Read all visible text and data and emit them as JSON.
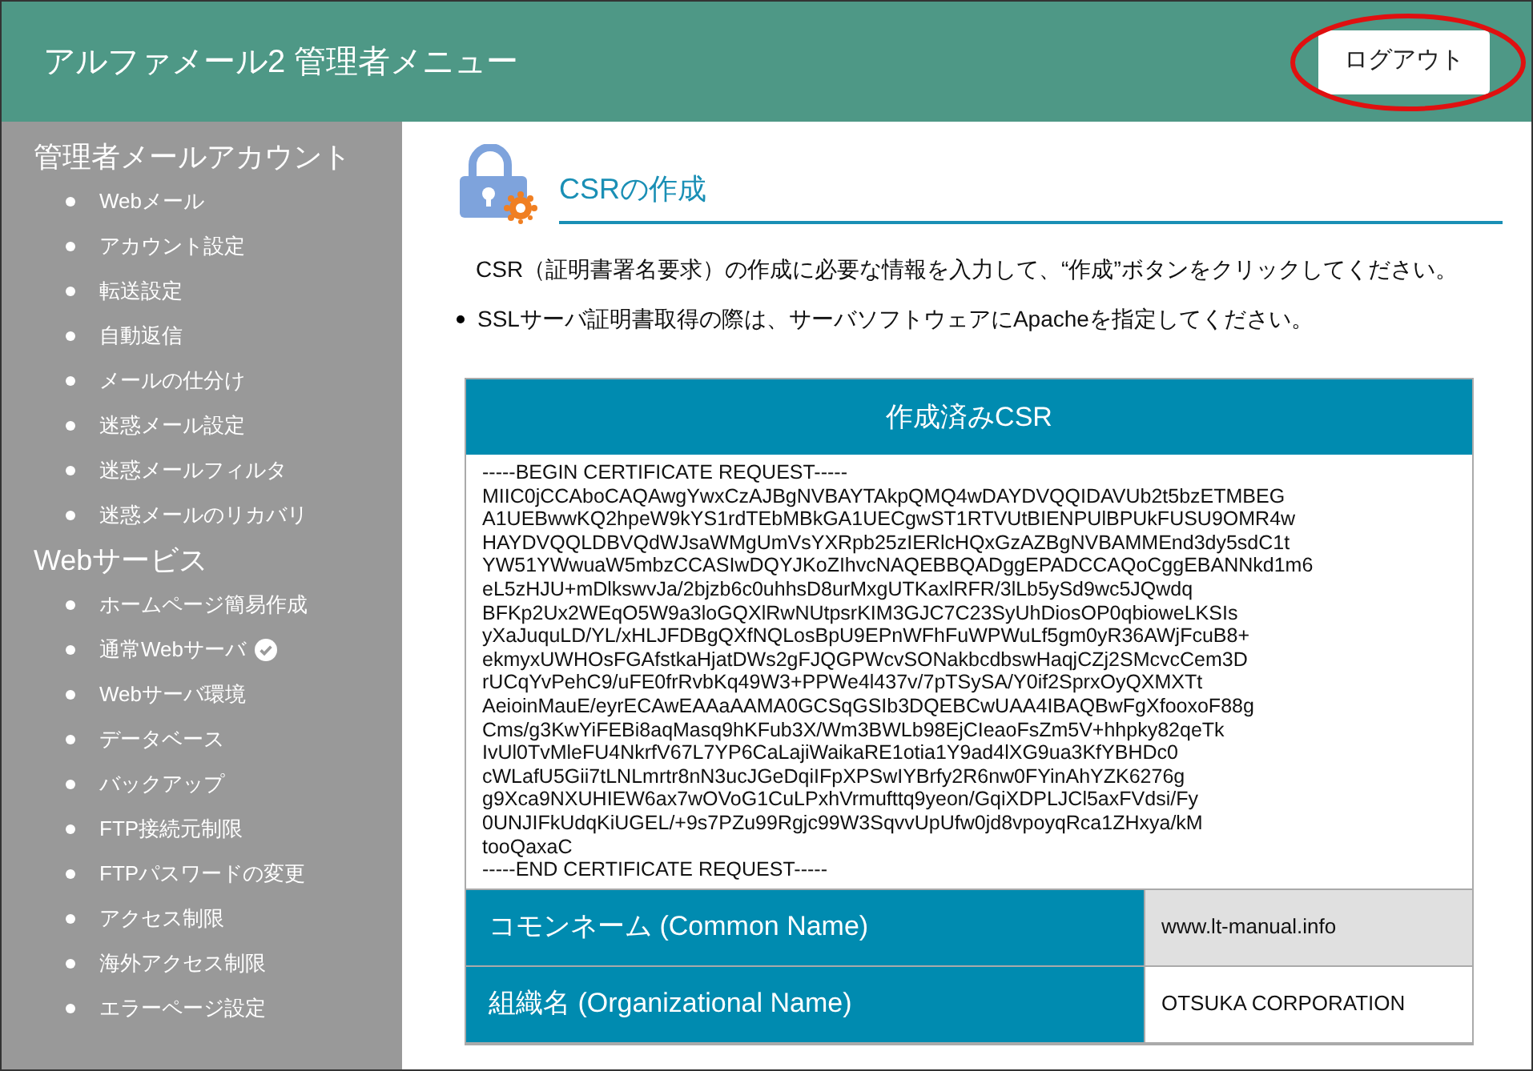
{
  "header": {
    "title": "アルファメール2 管理者メニュー",
    "logout_button": "ログアウト",
    "logout_circled": true
  },
  "sidebar": {
    "sections": [
      {
        "title": "管理者メールアカウント",
        "items": [
          {
            "label": "Webメール",
            "verified": false
          },
          {
            "label": "アカウント設定",
            "verified": false
          },
          {
            "label": "転送設定",
            "verified": false
          },
          {
            "label": "自動返信",
            "verified": false
          },
          {
            "label": "メールの仕分け",
            "verified": false
          },
          {
            "label": "迷惑メール設定",
            "verified": false
          },
          {
            "label": "迷惑メールフィルタ",
            "verified": false
          },
          {
            "label": "迷惑メールのリカバリ",
            "verified": false
          }
        ]
      },
      {
        "title": "Webサービス",
        "items": [
          {
            "label": "ホームページ簡易作成",
            "verified": false
          },
          {
            "label": "通常Webサーバ",
            "verified": true
          },
          {
            "label": "Webサーバ環境",
            "verified": false
          },
          {
            "label": "データベース",
            "verified": false
          },
          {
            "label": "バックアップ",
            "verified": false
          },
          {
            "label": "FTP接続元制限",
            "verified": false
          },
          {
            "label": "FTPパスワードの変更",
            "verified": false
          },
          {
            "label": "アクセス制限",
            "verified": false
          },
          {
            "label": "海外アクセス制限",
            "verified": false
          },
          {
            "label": "エラーページ設定",
            "verified": false
          }
        ]
      }
    ]
  },
  "main": {
    "title": "CSRの作成",
    "intro": "CSR（証明書署名要求）の作成に必要な情報を入力して、“作成”ボタンをクリックしてください。",
    "notes": [
      "SSLサーバ証明書取得の際は、サーバソフトウェアにApacheを指定してください。"
    ],
    "csr_table": {
      "heading": "作成済みCSR",
      "csr_lines": [
        "-----BEGIN CERTIFICATE REQUEST-----",
        "MIIC0jCCAboCAQAwgYwxCzAJBgNVBAYTAkpQMQ4wDAYDVQQIDAVUb2t5bzETMBEG",
        "A1UEBwwKQ2hpeW9kYS1rdTEbMBkGA1UECgwST1RTVUtBIENPUlBPUkFUSU9OMR4w",
        "HAYDVQQLDBVQdWJsaWMgUmVsYXRpb25zIERlcHQxGzAZBgNVBAMMEnd3dy5sdC1t",
        "YW51YWwuaW5mbzCCASIwDQYJKoZIhvcNAQEBBQADggEPADCCAQoCggEBANNkd1m6",
        "eL5zHJU+mDlkswvJa/2bjzb6c0uhhsD8urMxgUTKaxlRFR/3lLb5ySd9wc5JQwdq",
        "BFKp2Ux2WEqO5W9a3loGQXlRwNUtpsrKIM3GJC7C23SyUhDiosOP0qbioweLKSIs",
        "yXaJuquLD/YL/xHLJFDBgQXfNQLosBpU9EPnWFhFuWPWuLf5gm0yR36AWjFcuB8+",
        "ekmyxUWHOsFGAfstkaHjatDWs2gFJQGPWcvSONakbcdbswHaqjCZj2SMcvcCem3D",
        "rUCqYvPehC9/uFE0frRvbKq49W3+PPWe4l437v/7pTSySA/Y0if2SprxOyQXMXTt",
        "AeioinMauE/eyrECAwEAAaAAMA0GCSqGSIb3DQEBCwUAA4IBAQBwFgXfooxoF88g",
        "Cms/g3KwYiFEBi8aqMasq9hKFub3X/Wm3BWLb98EjCIeaoFsZm5V+hhpky82qeTk",
        "IvUl0TvMleFU4NkrfV67L7YP6CaLajiWaikaRE1otia1Y9ad4lXG9ua3KfYBHDc0",
        "cWLafU5Gii7tLNLmrtr8nN3ucJGeDqiIFpXPSwIYBrfy2R6nw0FYinAhYZK6276g",
        "g9Xca9NXUHIEW6ax7wOVoG1CuLPxhVrmufttq9yeon/GqiXDPLJCl5axFVdsi/Fy",
        "0UNJIFkUdqKiUGEL/+9s7PZu99Rgjc99W3SqvvUpUfw0jd8vpoyqRca1ZHxya/kM",
        "tooQaxaC",
        "-----END CERTIFICATE REQUEST-----"
      ],
      "rows": [
        {
          "label": "コモンネーム (Common Name)",
          "value": "www.lt-manual.info",
          "shaded": true
        },
        {
          "label": "組織名 (Organizational Name)",
          "value": "OTSUKA CORPORATION",
          "shaded": false
        }
      ]
    }
  }
}
